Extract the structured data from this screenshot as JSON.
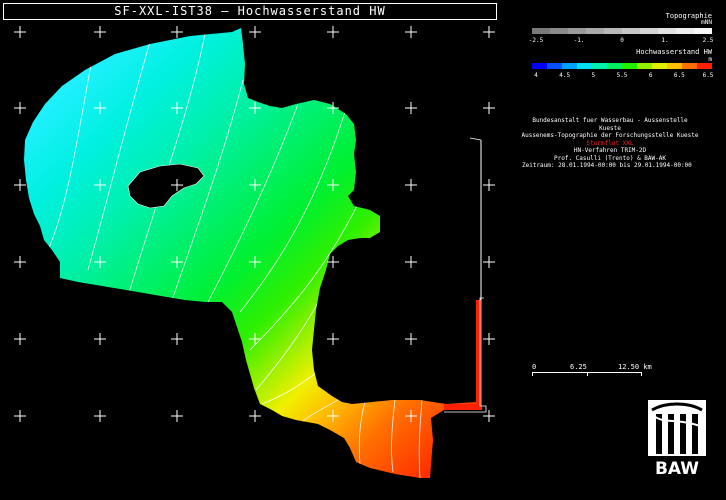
{
  "title": "SF-XXL-IST38 — Hochwasserstand HW",
  "topo_legend": {
    "title": "Topographie",
    "unit": "mNN",
    "ticks": [
      "-2.5",
      "-1.",
      "0",
      "1.",
      "2.5"
    ],
    "colors": [
      "#7a7a7a",
      "#8a8a8a",
      "#9a9a9a",
      "#a9a9a9",
      "#b8b8b8",
      "#c7c7c7",
      "#d5d5d5",
      "#e2e2e2",
      "#eeeeee",
      "#f8f8f8"
    ]
  },
  "hw_legend": {
    "title": "Hochwasserstand HW",
    "unit": "m",
    "ticks": [
      "4",
      "4.5",
      "5",
      "5.5",
      "6",
      "6.5",
      "6.5"
    ],
    "colors": [
      "#0000ff",
      "#0050ff",
      "#00a0ff",
      "#00e0f0",
      "#00f0b0",
      "#00f060",
      "#20f000",
      "#90f000",
      "#e0f000",
      "#ffc000",
      "#ff7000",
      "#ff2000"
    ]
  },
  "info": {
    "line1": "Bundesanstalt fuer Wasserbau - Aussenstelle Kueste",
    "line2": "Aussenems-Topographie der Forschungsstelle Kueste",
    "line3": "Sturmflut XXL",
    "line4": "HN-Verfahren TRIM-2D",
    "line5": "Prof. Casulli (Trento) & BAW-AK",
    "line6": "Zeitraum: 28.01.1994-00:00 bis 29.01.1994-00:00"
  },
  "scalebar": {
    "labels": [
      "0",
      "6.25",
      "12.50 km"
    ]
  },
  "logo": {
    "text": "BAW"
  },
  "colors": {
    "background": "#000000",
    "grid_cross": "#ffffff",
    "river_line": "#ffffff",
    "red_channel": "#ff2000"
  }
}
